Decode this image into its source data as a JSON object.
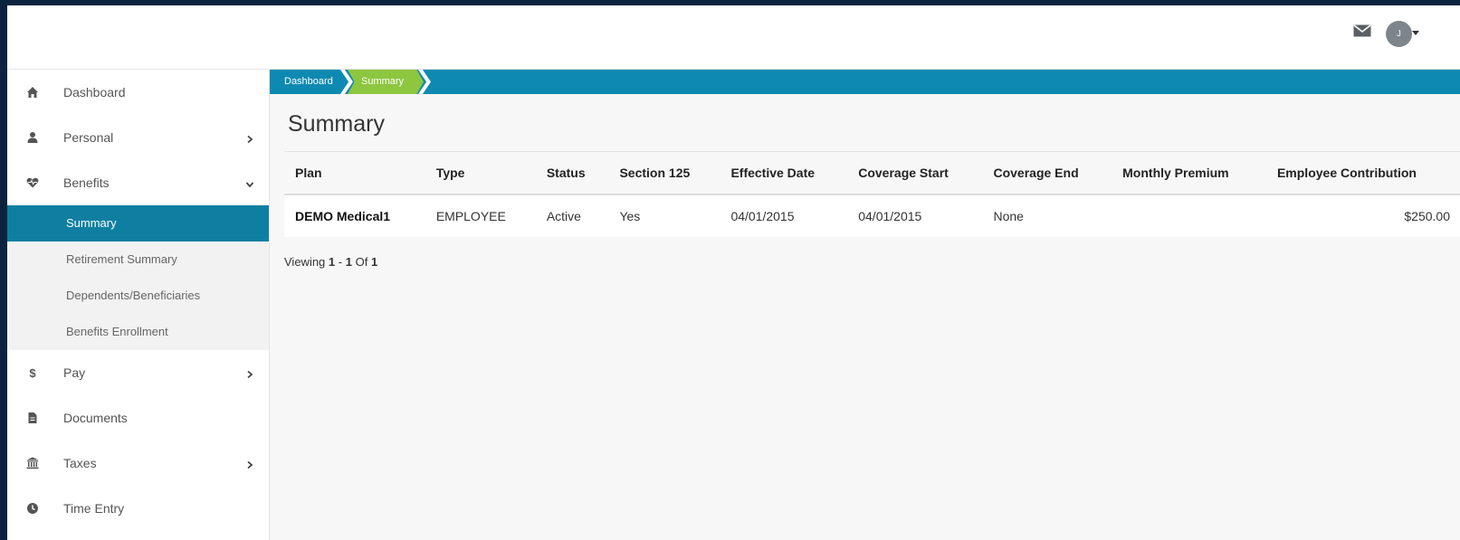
{
  "header": {
    "mail_icon": "envelope-icon",
    "avatar_initial": "J"
  },
  "sidebar": {
    "items": [
      {
        "label": "Dashboard",
        "icon": "home-icon"
      },
      {
        "label": "Personal",
        "icon": "user-icon"
      },
      {
        "label": "Benefits",
        "icon": "heartbeat-icon"
      },
      {
        "label": "Pay",
        "icon": "dollar-icon"
      },
      {
        "label": "Documents",
        "icon": "file-icon"
      },
      {
        "label": "Taxes",
        "icon": "bank-icon"
      },
      {
        "label": "Time Entry",
        "icon": "clock-icon"
      }
    ],
    "benefits_sub": [
      {
        "label": "Summary",
        "active": true
      },
      {
        "label": "Retirement Summary"
      },
      {
        "label": "Dependents/Beneficiaries"
      },
      {
        "label": "Benefits Enrollment"
      }
    ]
  },
  "breadcrumb": [
    "Dashboard",
    "Summary"
  ],
  "page_title": "Summary",
  "table": {
    "columns": [
      "Plan",
      "Type",
      "Status",
      "Section 125",
      "Effective Date",
      "Coverage Start",
      "Coverage End",
      "Monthly Premium",
      "Employee Contribution"
    ],
    "rows": [
      [
        "DEMO Medical1",
        "EMPLOYEE",
        "Active",
        "Yes",
        "04/01/2015",
        "04/01/2015",
        "None",
        "",
        "$250.00"
      ]
    ]
  },
  "pagination": {
    "prefix": "Viewing",
    "from": "1",
    "dash": "-",
    "to": "1",
    "of": "Of",
    "total": "1"
  },
  "colors": {
    "breadcrumb_bar": "#0e8ab2",
    "breadcrumb_active": "#8dc63f",
    "sidebar_active": "#0e7fa1",
    "page_border": "#0c2340"
  }
}
